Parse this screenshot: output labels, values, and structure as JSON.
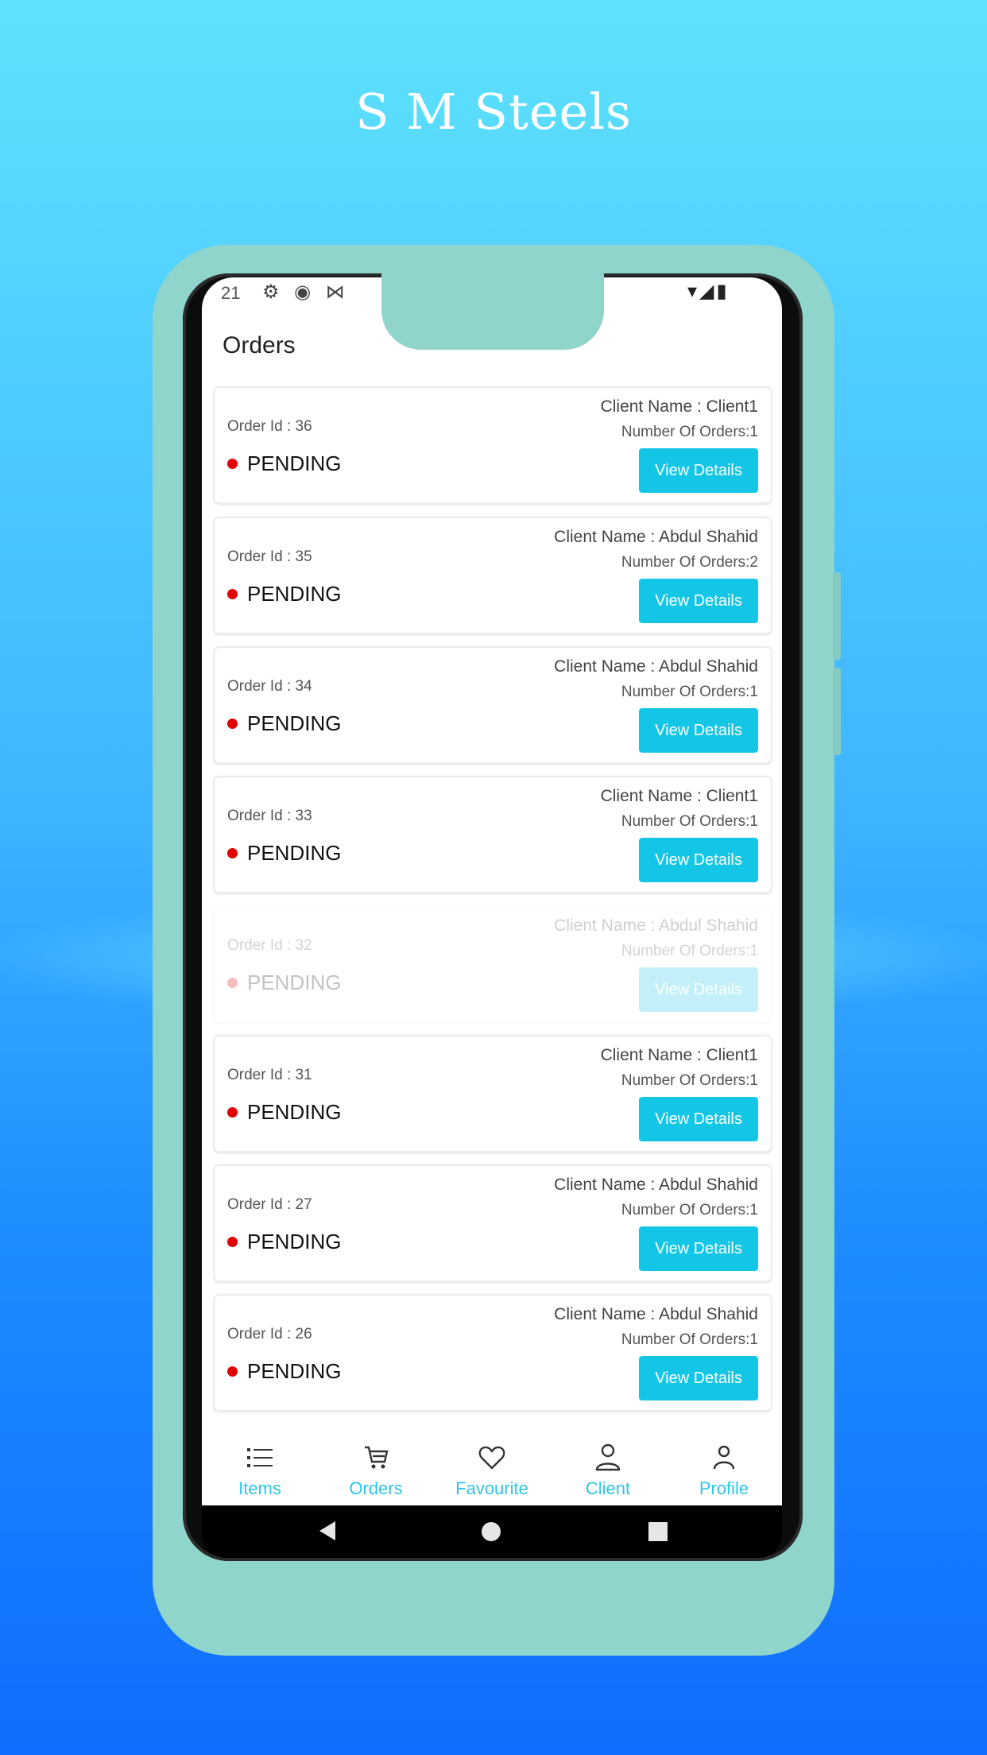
{
  "app_title": "S M Steels",
  "status_bar": {
    "time": "21",
    "left_icons": "⚙ ◉ ⋈",
    "right_icons": "▾◢▮"
  },
  "page_title": "Orders",
  "orders": [
    {
      "order_id": "Order Id : 36",
      "status": "PENDING",
      "client": "Client Name : Client1",
      "num_orders": "Number Of Orders:1",
      "button": "View Details"
    },
    {
      "order_id": "Order Id : 35",
      "status": "PENDING",
      "client": "Client Name : Abdul Shahid",
      "num_orders": "Number Of Orders:2",
      "button": "View Details"
    },
    {
      "order_id": "Order Id : 34",
      "status": "PENDING",
      "client": "Client Name : Abdul Shahid",
      "num_orders": "Number Of Orders:1",
      "button": "View Details"
    },
    {
      "order_id": "Order Id : 33",
      "status": "PENDING",
      "client": "Client Name : Client1",
      "num_orders": "Number Of Orders:1",
      "button": "View Details"
    },
    {
      "order_id": "Order Id : 32",
      "status": "PENDING",
      "client": "Client Name : Abdul Shahid",
      "num_orders": "Number Of Orders:1",
      "button": "View Details"
    },
    {
      "order_id": "Order Id : 31",
      "status": "PENDING",
      "client": "Client Name : Client1",
      "num_orders": "Number Of Orders:1",
      "button": "View Details"
    },
    {
      "order_id": "Order Id : 27",
      "status": "PENDING",
      "client": "Client Name : Abdul Shahid",
      "num_orders": "Number Of Orders:1",
      "button": "View Details"
    },
    {
      "order_id": "Order Id : 26",
      "status": "PENDING",
      "client": "Client Name : Abdul Shahid",
      "num_orders": "Number Of Orders:1",
      "button": "View Details"
    }
  ],
  "bottom_nav": [
    {
      "label": "Items",
      "icon": "list-icon"
    },
    {
      "label": "Orders",
      "icon": "cart-icon"
    },
    {
      "label": "Favourite",
      "icon": "heart-icon"
    },
    {
      "label": "Client",
      "icon": "user-icon"
    },
    {
      "label": "Profile",
      "icon": "profile-icon"
    }
  ],
  "colors": {
    "accent": "#14c6e6",
    "pending_dot": "#e00000",
    "frame": "#8fd5cc",
    "nav_label": "#2ec5e6"
  }
}
